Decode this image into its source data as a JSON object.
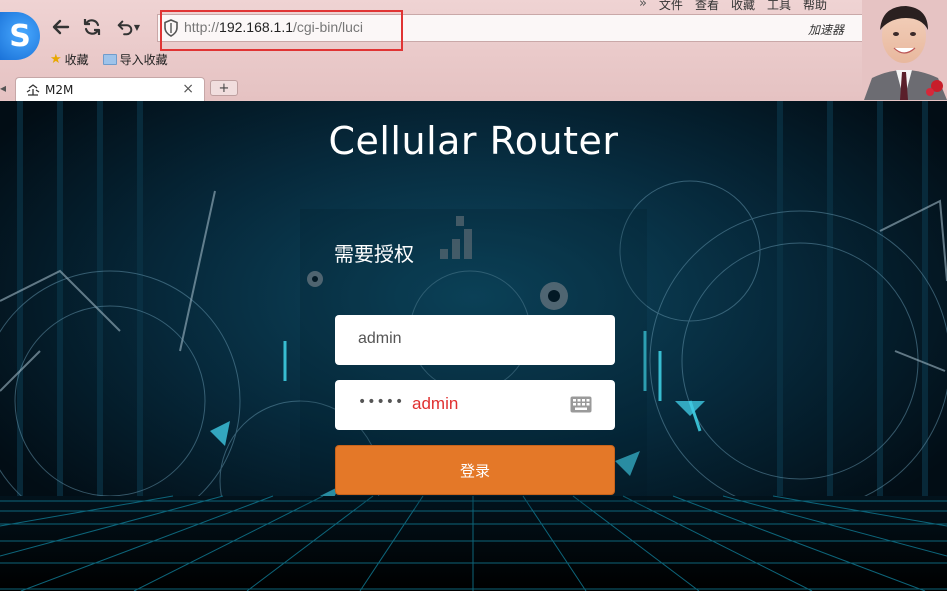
{
  "browser": {
    "menu": [
      "文件",
      "查看",
      "收藏",
      "工具",
      "帮助"
    ],
    "url_prefix": "http://",
    "url_host": "192.168.1.1",
    "url_path": "/cgi-bin/luci",
    "accelerator_label": "加速器",
    "bookmarks": [
      {
        "label": "收藏",
        "icon": "star-icon"
      },
      {
        "label": "导入收藏",
        "icon": "folder-icon"
      }
    ],
    "tab": {
      "title": "M2M",
      "close": "×"
    },
    "new_tab": "+",
    "logo_letter": "S",
    "highlight_color": "#e03434"
  },
  "page": {
    "title": "Cellular Router",
    "auth_heading": "需要授权",
    "username_value": "admin",
    "password_dots": "•••••",
    "password_annotation": "admin",
    "login_label": "登录",
    "login_color": "#e47828",
    "annotation_color": "#e03030"
  }
}
